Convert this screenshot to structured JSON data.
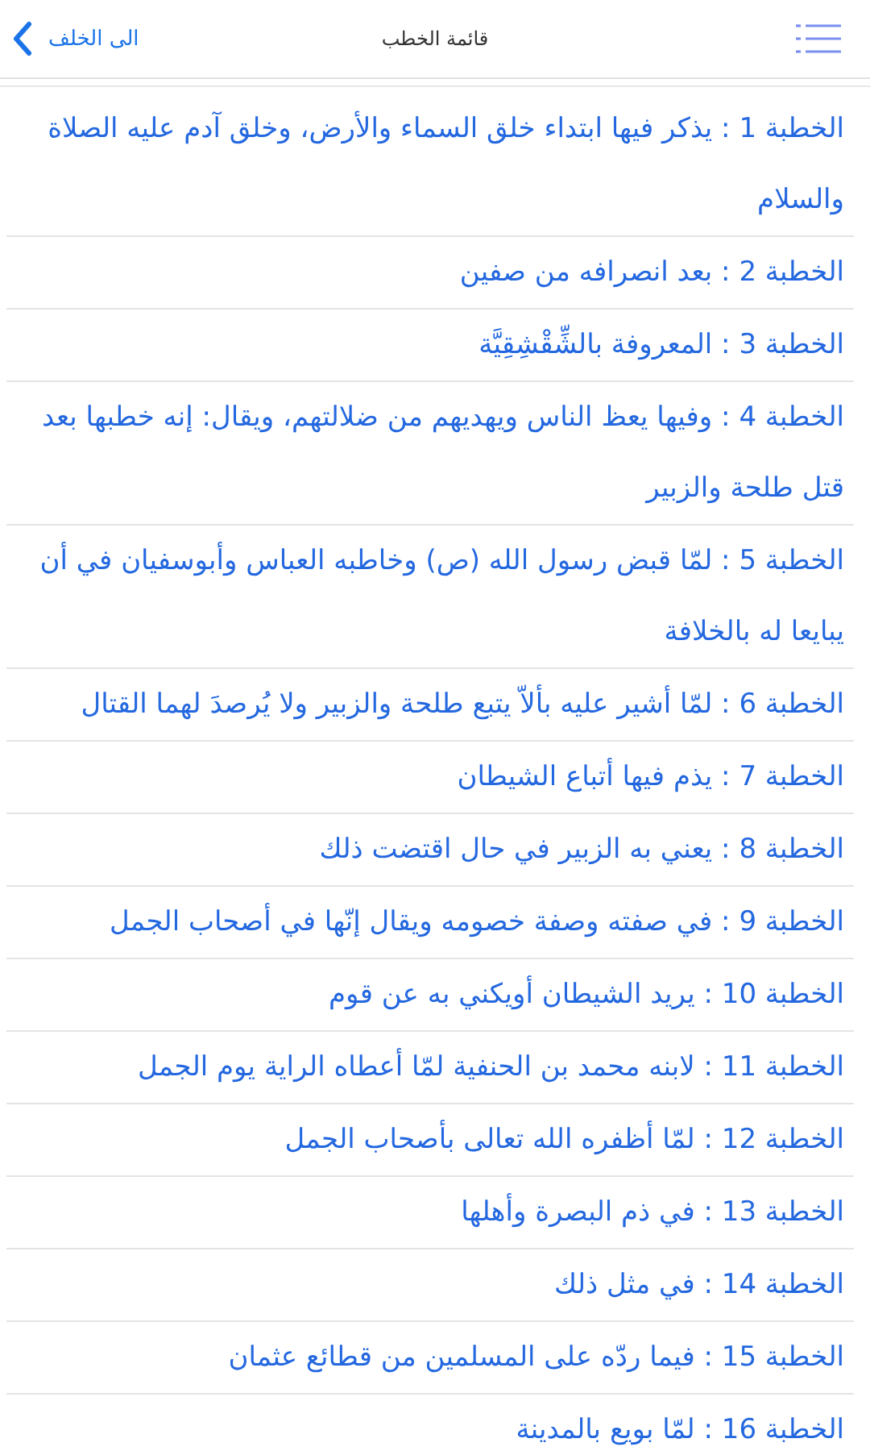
{
  "nav_bar": {
    "back_label": "الى الخلف",
    "title": "قائمة الخطب"
  },
  "sermons": [
    {
      "text": "الخطبة 1 : يذكر فيها ابتداء خلق السماء والأرض، وخلق آدم عليه الصلاة والسلام"
    },
    {
      "text": "الخطبة 2 : بعد انصرافه من صفين"
    },
    {
      "text": "الخطبة 3 : المعروفة بالشِّقْشِقِيَّة"
    },
    {
      "text": "الخطبة 4 : وفيها يعظ الناس ويهديهم من ضلالتهم، ويقال: إنه خطبها بعد قتل طلحة والزبير"
    },
    {
      "text": "الخطبة 5 : لمّا قبض رسول الله (ص) وخاطبه العباس وأبوسفيان في أن يبايعا له بالخلافة"
    },
    {
      "text": "الخطبة 6 : لمّا أشير عليه بألاّ يتبع طلحة والزبير ولا يُرصدَ لهما القتال"
    },
    {
      "text": "الخطبة 7 : يذم فيها أتباع الشيطان"
    },
    {
      "text": "الخطبة 8 : يعني به الزبير في حال اقتضت ذلك"
    },
    {
      "text": "الخطبة 9 : في صفته وصفة خصومه ويقال إنّها في أصحاب الجمل"
    },
    {
      "text": "الخطبة 10 : يريد الشيطان أويكني به عن قوم"
    },
    {
      "text": "الخطبة 11 : لابنه محمد بن الحنفية لمّا أعطاه الراية يوم الجمل"
    },
    {
      "text": "الخطبة 12 : لمّا أظفره الله تعالى بأصحاب الجمل"
    },
    {
      "text": "الخطبة 13 : في ذم البصرة وأهلها"
    },
    {
      "text": "الخطبة 14 : في مثل ذلك"
    },
    {
      "text": "الخطبة 15 : فيما ردّه على المسلمين من قطائع عثمان"
    },
    {
      "text": "الخطبة 16 : لمّا بويع بالمدينة"
    }
  ]
}
